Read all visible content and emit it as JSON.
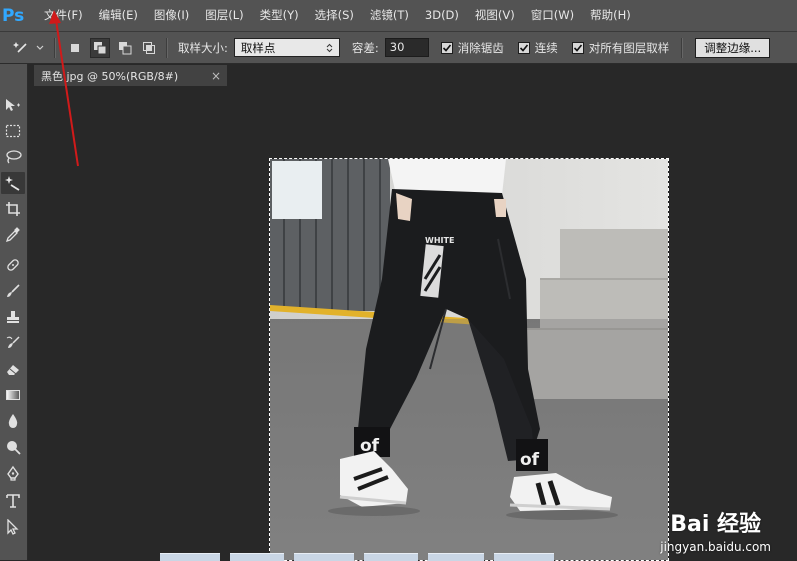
{
  "app": {
    "logo": "Ps"
  },
  "menu": {
    "items": [
      "文件(F)",
      "编辑(E)",
      "图像(I)",
      "图层(L)",
      "类型(Y)",
      "选择(S)",
      "滤镜(T)",
      "3D(D)",
      "视图(V)",
      "窗口(W)",
      "帮助(H)"
    ]
  },
  "options": {
    "sample_size_label": "取样大小:",
    "sample_size_value": "取样点",
    "tolerance_label": "容差:",
    "tolerance_value": "30",
    "anti_alias_label": "消除锯齿",
    "contiguous_label": "连续",
    "sample_all_layers_label": "对所有图层取样",
    "refine_edge_button": "调整边缘..."
  },
  "document": {
    "tab_title": "黑色.jpg @ 50%(RGB/8#)",
    "close_glyph": "×",
    "zoom": "50%"
  },
  "photo": {
    "logo_text": "WHITE",
    "left_cuff_text": "of",
    "right_cuff_text": "of"
  },
  "watermark": {
    "brand": "Bai 经验",
    "url": "jingyan.baidu.com"
  },
  "colors": {
    "chrome": "#535353",
    "workspace": "#282828",
    "accent": "#31a8ff",
    "annotation_arrow": "#d11a1a"
  },
  "icons": {
    "toolbar": [
      "move-icon",
      "marquee-icon",
      "lasso-icon",
      "magic-wand-icon",
      "crop-icon",
      "eyedropper-icon",
      "healing-brush-icon",
      "brush-icon",
      "clone-stamp-icon",
      "history-brush-icon",
      "eraser-icon",
      "gradient-icon",
      "blur-icon",
      "dodge-icon",
      "pen-icon",
      "type-icon",
      "path-selection-icon"
    ]
  }
}
